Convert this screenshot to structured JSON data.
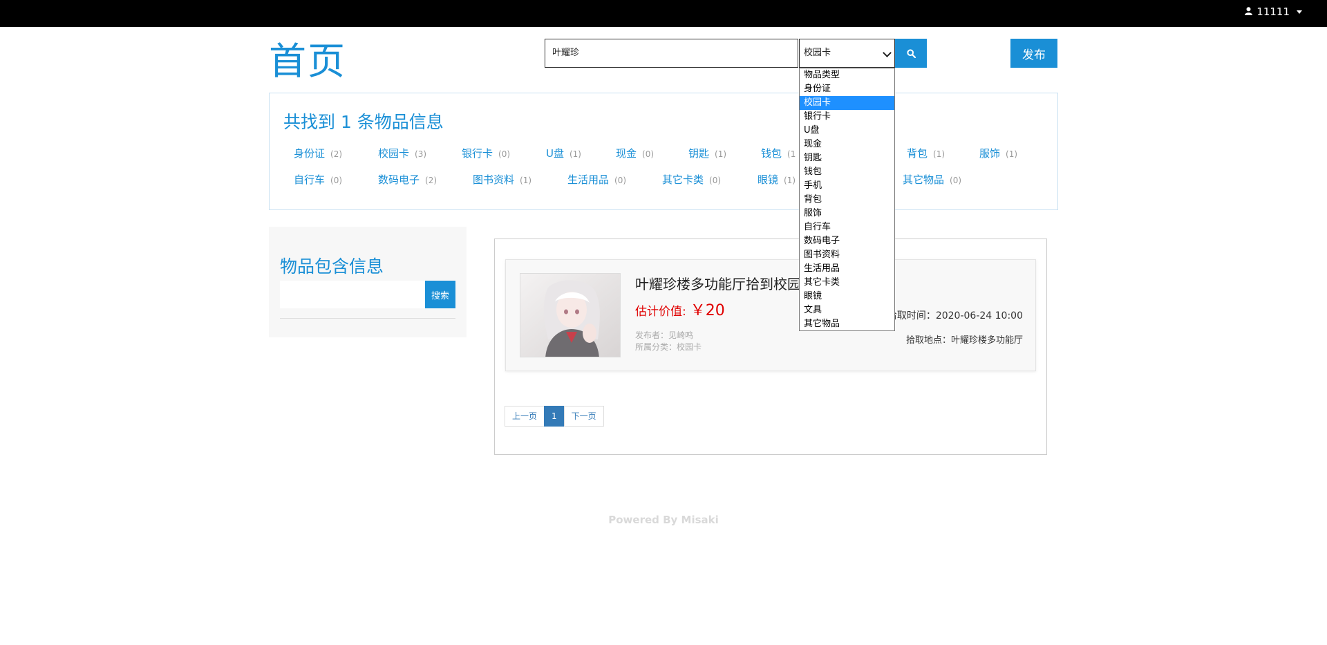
{
  "topbar": {
    "username": "11111"
  },
  "header": {
    "logo": "首页",
    "search_value": "叶耀珍",
    "select_value": "校园卡",
    "publish_label": "发布"
  },
  "dropdown": {
    "options": [
      "物品类型",
      "身份证",
      "校园卡",
      "银行卡",
      "U盘",
      "现金",
      "钥匙",
      "钱包",
      "手机",
      "背包",
      "服饰",
      "自行车",
      "数码电子",
      "图书资料",
      "生活用品",
      "其它卡类",
      "眼镜",
      "文具",
      "其它物品"
    ],
    "selected_index": 2
  },
  "summary": {
    "title": "共找到 1 条物品信息",
    "row1": [
      {
        "label": "身份证",
        "count": "(2)"
      },
      {
        "label": "校园卡",
        "count": "(3)"
      },
      {
        "label": "银行卡",
        "count": "(0)"
      },
      {
        "label": "U盘",
        "count": "(1)"
      },
      {
        "label": "现金",
        "count": "(0)"
      },
      {
        "label": "钥匙",
        "count": "(1)"
      },
      {
        "label": "钱包",
        "count": "(1"
      },
      {
        "label": "背包",
        "count": "(1)"
      },
      {
        "label": "服饰",
        "count": "(1)"
      }
    ],
    "row2": [
      {
        "label": "自行车",
        "count": "(0)"
      },
      {
        "label": "数码电子",
        "count": "(2)"
      },
      {
        "label": "图书资料",
        "count": "(1)"
      },
      {
        "label": "生活用品",
        "count": "(0)"
      },
      {
        "label": "其它卡类",
        "count": "(0)"
      },
      {
        "label": "眼镜",
        "count": "(1)"
      },
      {
        "label": "其它物品",
        "count": "(0)"
      }
    ]
  },
  "sidebar": {
    "title": "物品包含信息",
    "search_label": "搜索"
  },
  "item": {
    "title": "叶耀珍楼多功能厅拾到校园",
    "price_label": "估计价值:",
    "price_value": "￥20",
    "publisher": "发布者：见崎鸣",
    "category": "所属分类：校园卡",
    "time": "拾取时间：2020-06-24 10:00",
    "place": "拾取地点：叶耀珍楼多功能厅"
  },
  "pager": {
    "prev": "上一页",
    "current": "1",
    "next": "下一页"
  },
  "footer": {
    "text": "Powered By Misaki"
  },
  "colors": {
    "accent": "#1a8fd6",
    "price": "#e00000",
    "pager_active": "#337ab7"
  }
}
